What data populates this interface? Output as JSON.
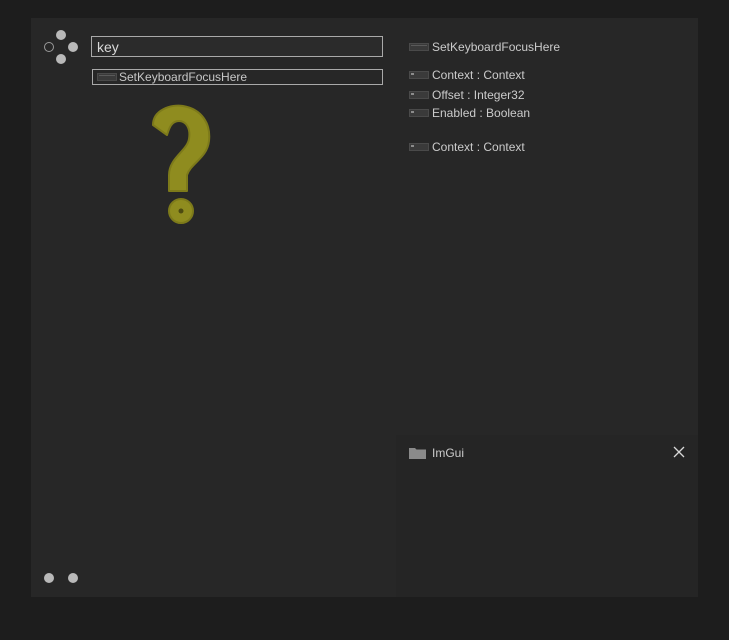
{
  "search": {
    "query": "key"
  },
  "results": [
    {
      "label": "SetKeyboardFocusHere"
    }
  ],
  "detail": {
    "title": "SetKeyboardFocusHere",
    "params": [
      {
        "label": "Context : Context"
      },
      {
        "label": "Offset : Integer32"
      },
      {
        "label": "Enabled : Boolean"
      }
    ],
    "outputs": [
      {
        "label": "Context : Context"
      }
    ]
  },
  "namespace": {
    "label": "ImGui"
  },
  "icons": {
    "nav": "navigation-dots-icon",
    "help": "question-mark-icon",
    "folder": "folder-icon",
    "close": "close-icon",
    "node": "node-icon"
  },
  "colors": {
    "window_bg": "#272727",
    "outer_bg": "#1d1d1d",
    "accent_olive": "#8f8c1f",
    "text": "#cbcbcb"
  }
}
